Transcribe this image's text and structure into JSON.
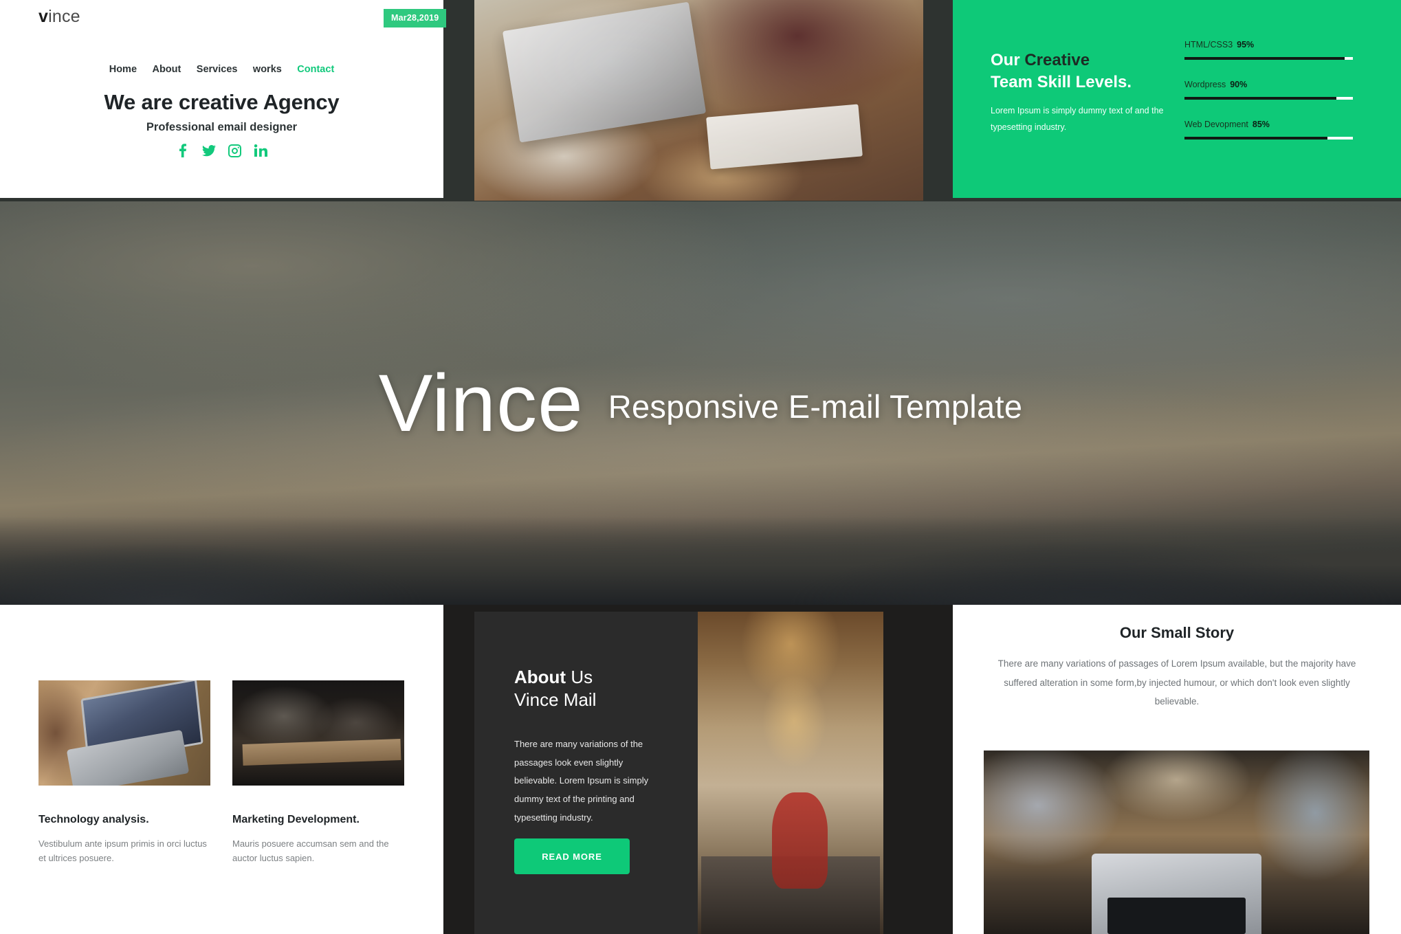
{
  "intro": {
    "brand_bold": "v",
    "brand_rest": "ince",
    "date_badge": "Mar28,2019",
    "nav": [
      {
        "label": "Home",
        "accent": false
      },
      {
        "label": "About",
        "accent": false
      },
      {
        "label": "Services",
        "accent": false
      },
      {
        "label": "works",
        "accent": false
      },
      {
        "label": "Contact",
        "accent": true
      }
    ],
    "title": "We are creative Agency",
    "subtitle": "Professional email designer",
    "socials": [
      "facebook-icon",
      "twitter-icon",
      "instagram-icon",
      "linkedin-icon"
    ]
  },
  "skills": {
    "heading_light": "Our ",
    "heading_dark": "Creative",
    "heading_line2": "Team Skill Levels.",
    "body": "Lorem Ipsum is simply dummy text of and the typesetting industry.",
    "items": [
      {
        "label": "HTML/CSS3",
        "percent": "95%",
        "value": 95
      },
      {
        "label": "Wordpress",
        "percent": "90%",
        "value": 90
      },
      {
        "label": "Web Devopment",
        "percent": "85%",
        "value": 85
      }
    ]
  },
  "hero": {
    "big": "Vince",
    "small": "Responsive E-mail Template"
  },
  "services": [
    {
      "image": "woman-typing-on-laptop-photo",
      "title": "Technology analysis.",
      "text": "Vestibulum ante ipsum primis in orci luctus et ultrices posuere."
    },
    {
      "image": "team-meeting-table-photo",
      "title": "Marketing Development.",
      "text": "Mauris posuere accumsan sem and the auctor luctus sapien."
    }
  ],
  "about": {
    "head_bold": "About",
    "head_rest": " Us",
    "head_line2": "Vince Mail",
    "text": "There are many variations of the passages look even slightly believable. Lorem Ipsum is simply dummy text of the printing and typesetting industry.",
    "button": "READ MORE",
    "image": "library-interior-photo"
  },
  "story": {
    "title": "Our Small Story",
    "text": "There are many variations of passages of Lorem Ipsum available, but the majority have suffered alteration in some form,by injected humour, or which don't look even slightly believable.",
    "image": "team-pointing-at-laptop-photo"
  },
  "colors": {
    "accent_green": "#0ec978",
    "badge_green": "#2fc97f",
    "dark_panel": "#2b2b2b",
    "page_dark": "#1e1d1c",
    "text_dark": "#1f2427",
    "text_muted": "#7b7f82"
  },
  "photos": {
    "top_banner": "man-typing-at-desk-photo",
    "hero_banner": "cloudy-sky-mountains-photo"
  }
}
